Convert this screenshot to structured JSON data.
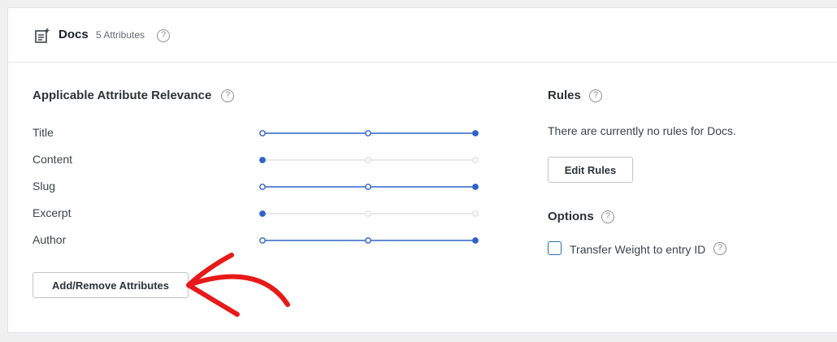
{
  "engine": {
    "name": "Docs",
    "attribute_count": "5 Attributes",
    "icon": "document-icon"
  },
  "relevance": {
    "title": "Applicable Attribute Relevance",
    "attributes": [
      {
        "label": "Title",
        "level": 3
      },
      {
        "label": "Content",
        "level": 1
      },
      {
        "label": "Slug",
        "level": 3
      },
      {
        "label": "Excerpt",
        "level": 1
      },
      {
        "label": "Author",
        "level": 3
      }
    ],
    "add_remove_label": "Add/Remove Attributes"
  },
  "rules": {
    "title": "Rules",
    "empty_text": "There are currently no rules for Docs.",
    "edit_label": "Edit Rules"
  },
  "options": {
    "title": "Options",
    "transfer_weight_label": "Transfer Weight to entry ID",
    "transfer_weight_checked": false
  },
  "help_glyph": "?",
  "colors": {
    "accent": "#2e63c9",
    "annotation_arrow": "#e81919",
    "track_inactive": "#e0e0e0"
  }
}
